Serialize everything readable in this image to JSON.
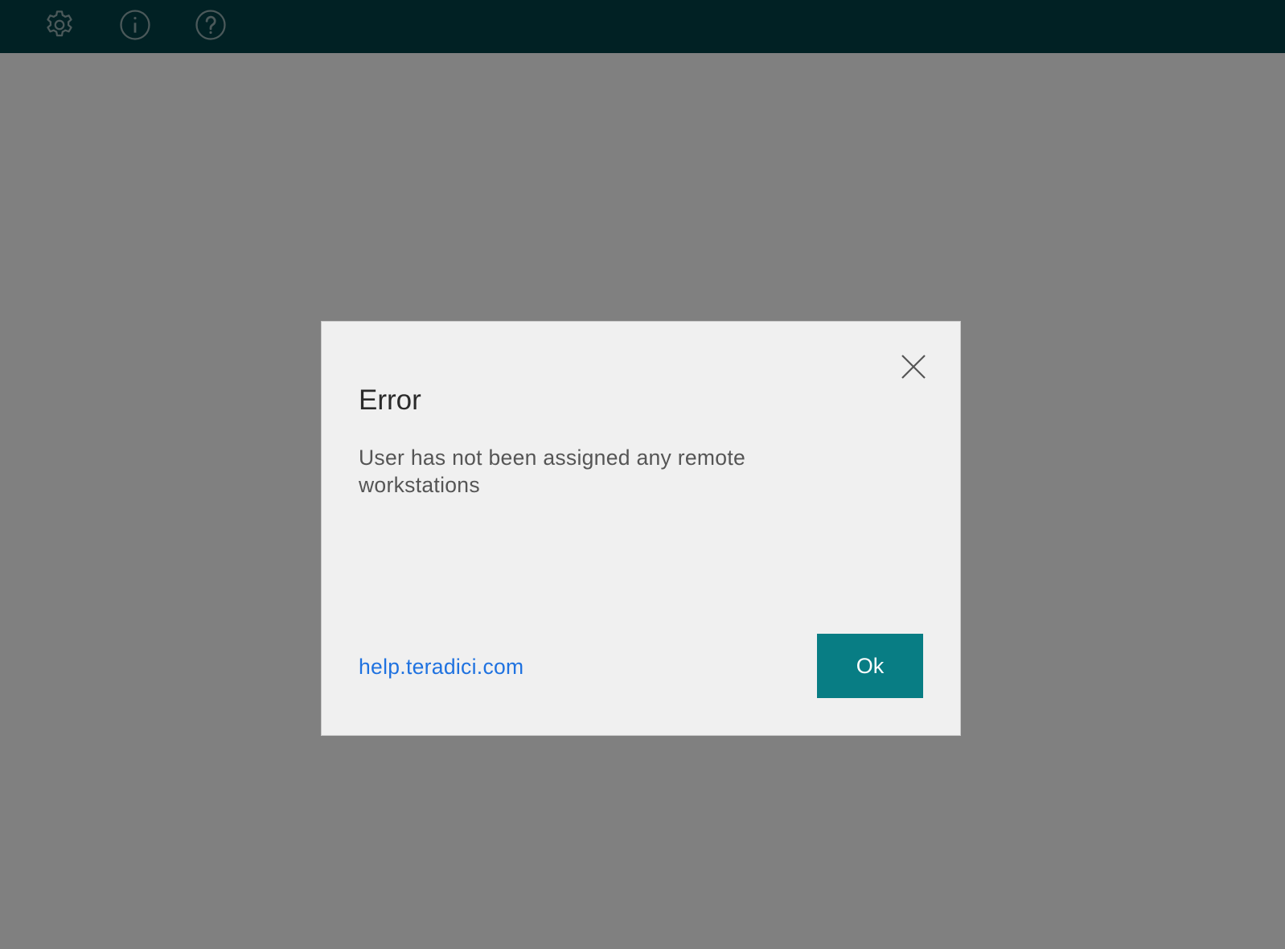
{
  "topbar": {
    "background": "#023f45",
    "icons": [
      "gear-icon",
      "info-icon",
      "help-icon"
    ]
  },
  "dialog": {
    "title": "Error",
    "message": "User has not been assigned any remote workstations",
    "help_link": "help.teradici.com",
    "ok_label": "Ok",
    "close_icon": "close-icon",
    "accent_color": "#087d84",
    "link_color": "#1f72e0"
  }
}
